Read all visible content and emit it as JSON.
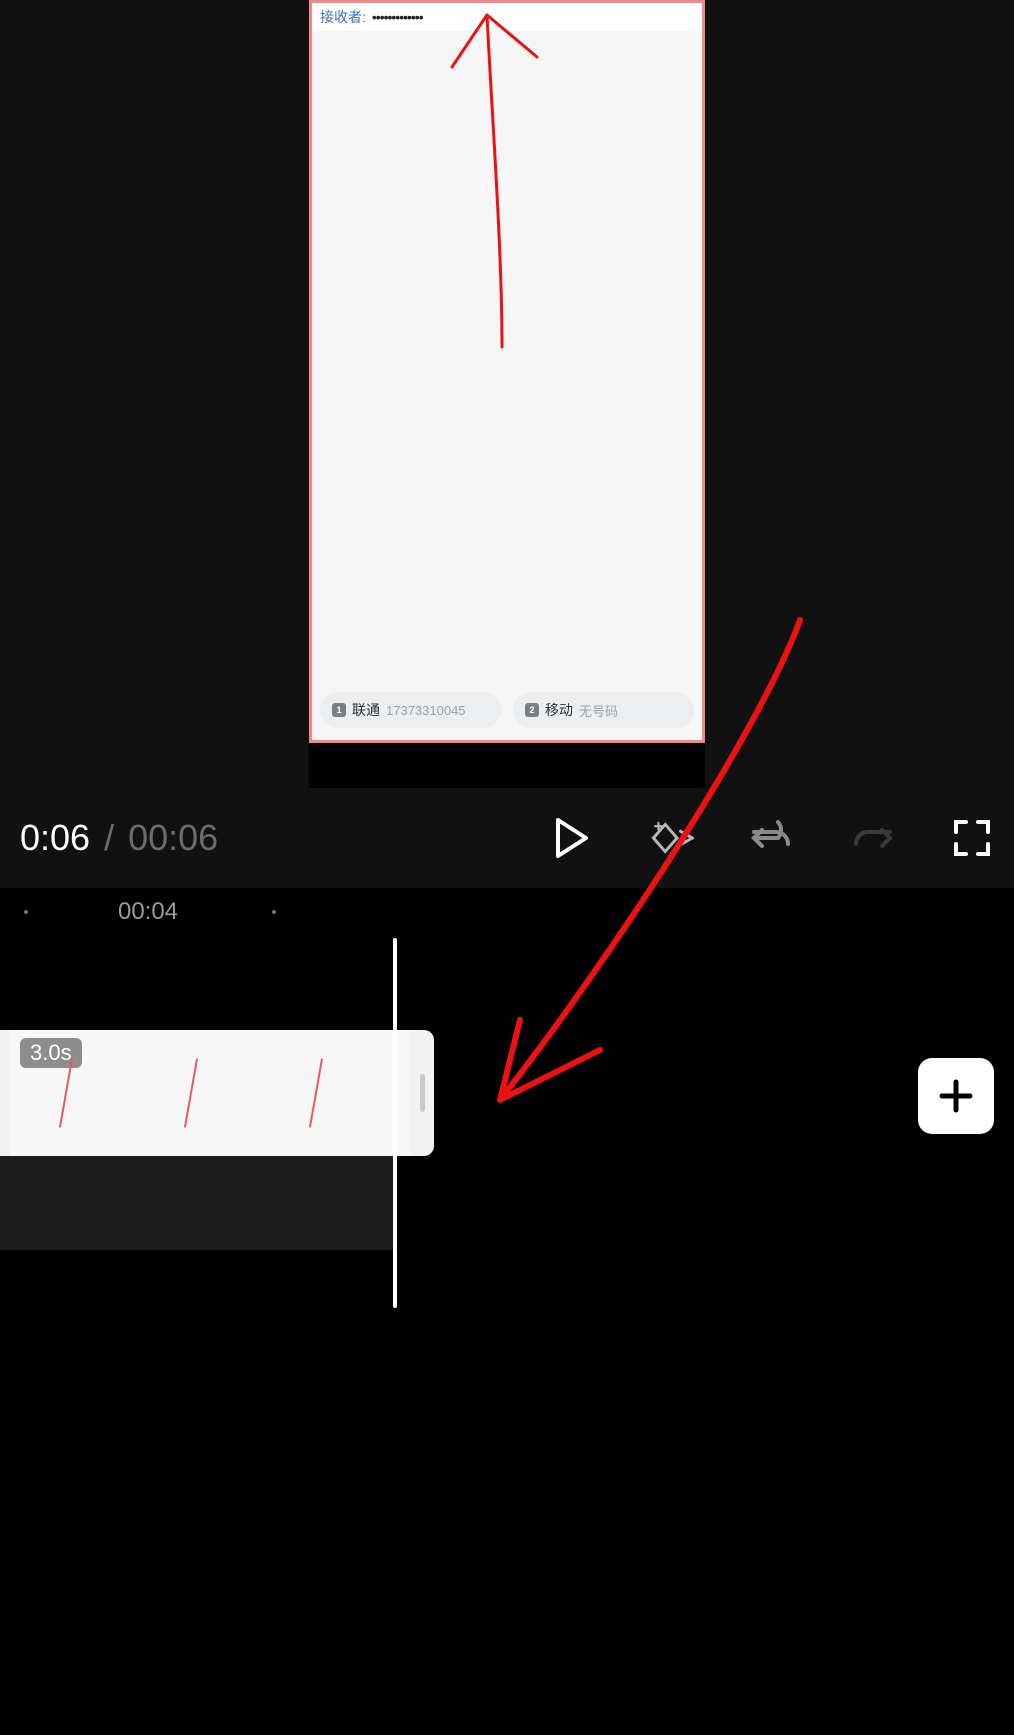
{
  "preview": {
    "topbar_label": "接收者:",
    "topbar_masked": "•••••••••••••",
    "sim1": {
      "badge": "1",
      "carrier": "联通",
      "number": "17373310045"
    },
    "sim2": {
      "badge": "2",
      "carrier": "移动",
      "number": "无号码"
    }
  },
  "playback": {
    "current": "0:06",
    "total": "00:06",
    "icons": {
      "play": "play-icon",
      "keyframe": "keyframe-add-icon",
      "undo": "undo-icon",
      "redo": "redo-icon",
      "fullscreen": "fullscreen-icon"
    }
  },
  "timeline": {
    "ruler_label": "00:04",
    "clip_duration": "3.0s",
    "add_label": "+"
  }
}
